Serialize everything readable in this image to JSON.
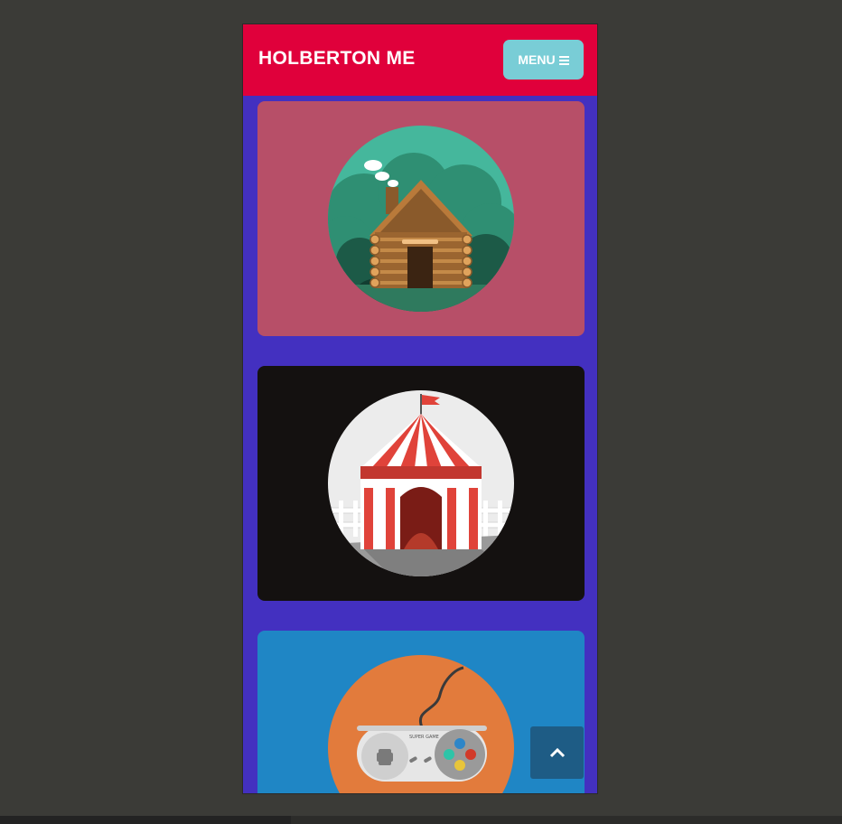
{
  "header": {
    "brand": "HOLBERTON ME",
    "menu_label": "MENU",
    "colors": {
      "header_bg": "#e0003b",
      "menu_bg": "#79cdd6",
      "page_bg": "#4330c0"
    }
  },
  "gallery": {
    "items": [
      {
        "illustration": "log-cabin-illustration",
        "card_color": "#b74f68",
        "circle_color": "#3fae96"
      },
      {
        "illustration": "circus-tent-illustration",
        "card_color": "#141110",
        "circle_color": "#eeeeee"
      },
      {
        "illustration": "game-controller-illustration",
        "card_color": "#1f86c5",
        "circle_color": "#e27b3c",
        "caption": "SUPER GAME"
      }
    ]
  },
  "back_to_top": {
    "icon": "chevron-up-icon"
  }
}
